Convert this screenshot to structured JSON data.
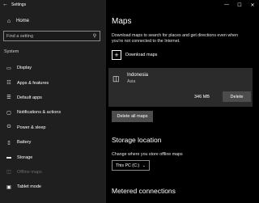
{
  "window": {
    "title": "Settings",
    "back_icon": "back-arrow-icon",
    "controls": {
      "minimize": "—",
      "maximize": "☐",
      "close": "✕"
    }
  },
  "sidebar": {
    "home_label": "Home",
    "search_placeholder": "Find a setting",
    "section": "System",
    "items": [
      {
        "label": "Display",
        "icon": "display-icon",
        "glyph": "▭"
      },
      {
        "label": "Apps & features",
        "icon": "apps-icon",
        "glyph": "☷"
      },
      {
        "label": "Default apps",
        "icon": "default-apps-icon",
        "glyph": "☰"
      },
      {
        "label": "Notifications & actions",
        "icon": "notifications-icon",
        "glyph": "▢"
      },
      {
        "label": "Power & sleep",
        "icon": "power-icon",
        "glyph": "⏻"
      },
      {
        "label": "Battery",
        "icon": "battery-icon",
        "glyph": "▯"
      },
      {
        "label": "Storage",
        "icon": "storage-icon",
        "glyph": "▬"
      },
      {
        "label": "Offline maps",
        "icon": "offline-maps-icon",
        "glyph": "◫"
      },
      {
        "label": "Tablet mode",
        "icon": "tablet-mode-icon",
        "glyph": "▣"
      }
    ]
  },
  "main": {
    "title": "Maps",
    "description": "Download maps to search for places and get directions even when you're not connected to the Internet.",
    "download_label": "Download maps",
    "map_item": {
      "name": "Indonesia",
      "region": "Asia",
      "size": "346 MB",
      "delete_label": "Delete"
    },
    "delete_all_label": "Delete all maps",
    "storage": {
      "title": "Storage location",
      "description": "Change where you store offline maps",
      "selected": "This PC (C:)"
    },
    "metered_title": "Metered connections"
  }
}
